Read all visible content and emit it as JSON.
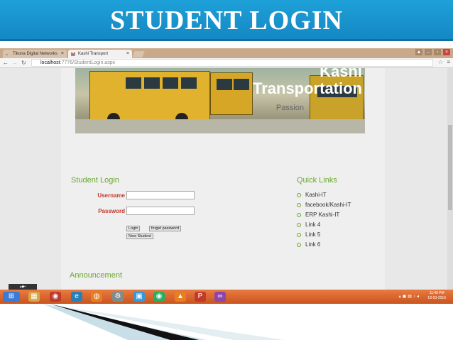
{
  "slide": {
    "title": "STUDENT LOGIN"
  },
  "browser": {
    "tabs": [
      {
        "label": "Tikona Digital Networks"
      },
      {
        "label": "Kashi Transport"
      }
    ],
    "url_host": "localhost",
    "url_path": ":7776/StudentLogin.aspx"
  },
  "banner": {
    "title_line1": "Kashi",
    "title_line2": "Transportation",
    "tagline": "Passion"
  },
  "login": {
    "heading": "Student Login",
    "username_label": "Username",
    "password_label": "Password",
    "login_button": "Login",
    "forgot_button": "forget password",
    "new_button": "New Student"
  },
  "quick_links": {
    "heading": "Quick Links",
    "items": [
      "Kashi-IT",
      "facebook/Kashi-IT",
      "ERP Kashi-IT",
      "Link 4",
      "Link 5",
      "Link 6"
    ]
  },
  "announcement": {
    "heading": "Announcement"
  },
  "taskbar": {
    "time": "11:49 PM",
    "date": "18-03-2016"
  },
  "colors": {
    "accent": "#6aa82b",
    "label": "#c0392b",
    "title_bar": "#1ea0d8",
    "taskbar": "#e26a2c"
  }
}
